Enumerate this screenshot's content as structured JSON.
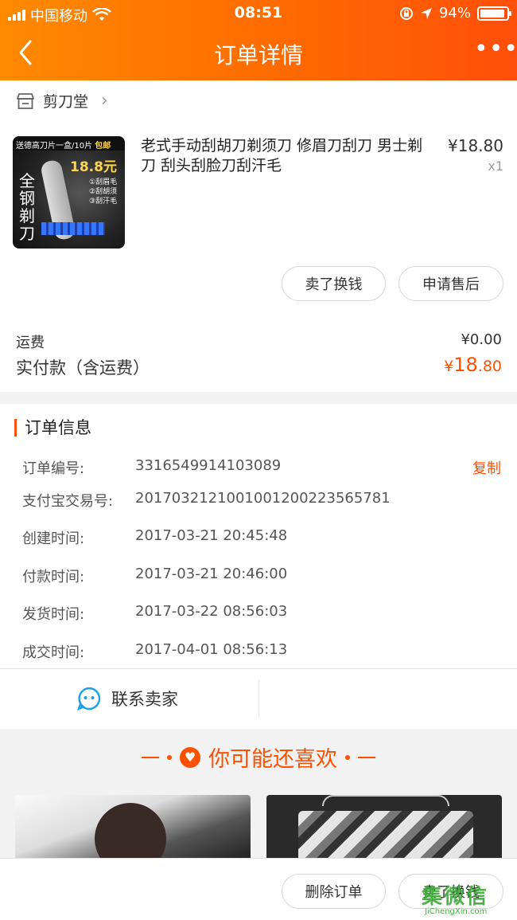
{
  "status_bar": {
    "carrier": "中国移动",
    "time": "08:51",
    "battery": "94%"
  },
  "nav": {
    "title": "订单详情",
    "more": "•••"
  },
  "shop": {
    "name": "剪刀堂"
  },
  "product": {
    "thumb_banner": "送德高刀片一盒/10片",
    "thumb_tag": "包邮",
    "thumb_price": "18.8元",
    "thumb_chars": "全钢剃刀",
    "thumb_features": [
      "①刮眉毛",
      "②刮胡须",
      "③刮汗毛"
    ],
    "title": "老式手动刮胡刀剃须刀 修眉刀刮刀 男士剃刀 刮头刮脸刀刮汗毛",
    "price": "¥18.80",
    "quantity": "x1"
  },
  "actions": {
    "sell_exchange": "卖了换钱",
    "after_sale": "申请售后",
    "delete_order": "删除订单"
  },
  "payment": {
    "shipping_label": "运费",
    "shipping_value": "¥0.00",
    "paid_label": "实付款（含运费）",
    "paid_currency": "¥",
    "paid_int": "18",
    "paid_dec": ".80"
  },
  "order_info": {
    "title": "订单信息",
    "copy_label": "复制",
    "rows": [
      {
        "label": "订单编号:",
        "value": "3316549914103089"
      },
      {
        "label": "支付宝交易号:",
        "value": "2017032121001001200223565781"
      },
      {
        "label": "创建时间:",
        "value": "2017-03-21 20:45:48"
      },
      {
        "label": "付款时间:",
        "value": "2017-03-21 20:46:00"
      },
      {
        "label": "发货时间:",
        "value": "2017-03-22 08:56:03"
      },
      {
        "label": "成交时间:",
        "value": "2017-04-01 08:56:13"
      }
    ]
  },
  "contact": {
    "label": "联系卖家"
  },
  "recommend": {
    "title": "你可能还喜欢"
  },
  "watermark": {
    "text": "集微信",
    "sub": "JiChengXin.com"
  },
  "colors": {
    "accent": "#ff5000",
    "header_start": "#ff8a00",
    "header_end": "#ff4f0a"
  }
}
